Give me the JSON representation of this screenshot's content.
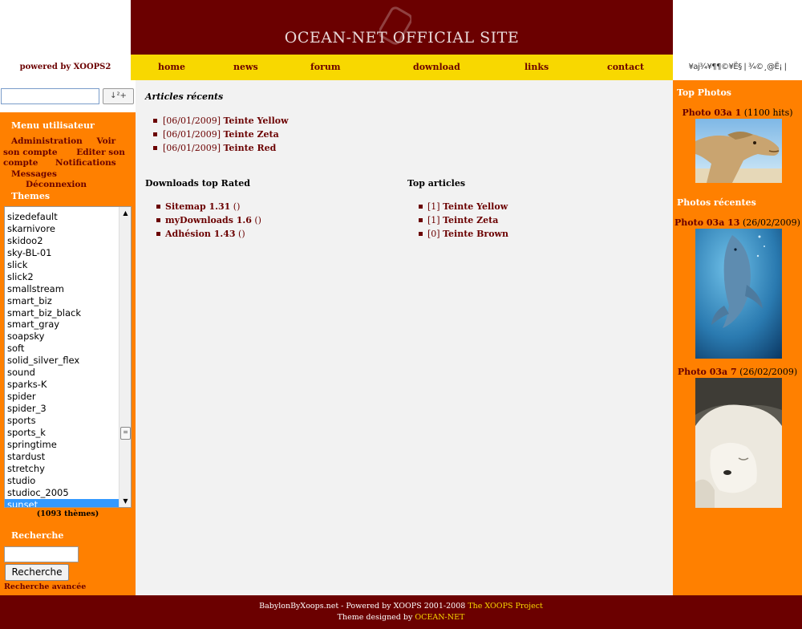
{
  "header": {
    "title": "OCEAN-NET OFFICIAL SITE",
    "powered_by": "powered by",
    "powered_brand": "XOOPS2",
    "garbled_text": "¥aj¾¥¶¶©¥Ë§ | ¾©¸@Ë¡ | ¥i¥¨¥i¥Y¥Ë"
  },
  "nav": {
    "home": "home",
    "news": "news",
    "forum": "forum",
    "download": "download",
    "links": "links",
    "contact": "contact"
  },
  "left": {
    "search_button": "↓²+",
    "user_menu_title": "Menu utilisateur",
    "user_menu": {
      "admin": "Administration",
      "view_account_1": "Voir",
      "view_account_2": "son compte",
      "edit_account_1": "Editer son",
      "edit_account_2": "compte",
      "notifications": "Notifications",
      "messages": "Messages",
      "logout": "Déconnexion"
    },
    "themes_title": "Themes",
    "themes": [
      "sizedefault",
      "skarnivore",
      "skidoo2",
      "sky-BL-01",
      "slick",
      "slick2",
      "smallstream",
      "smart_biz",
      "smart_biz_black",
      "smart_gray",
      "soapsky",
      "soft",
      "solid_silver_flex",
      "sound",
      "sparks-K",
      "spider",
      "spider_3",
      "sports",
      "sports_k",
      "springtime",
      "stardust",
      "stretchy",
      "studio",
      "studioc_2005",
      "sunset"
    ],
    "selected_theme": "sunset",
    "theme_count": "(1093 thèmes)",
    "search_title": "Recherche",
    "search_input": "",
    "search_button_label": "Recherche",
    "advanced_search": "Recherche avancée"
  },
  "center": {
    "recent_title": "Articles récents",
    "recent": [
      {
        "date": "[06/01/2009]",
        "title": "Teinte Yellow"
      },
      {
        "date": "[06/01/2009]",
        "title": "Teinte Zeta"
      },
      {
        "date": "[06/01/2009]",
        "title": "Teinte Red"
      }
    ],
    "downloads_title": "Downloads top Rated",
    "downloads": [
      {
        "title": "Sitemap 1.31",
        "extra": " ()"
      },
      {
        "title": "myDownloads 1.6",
        "extra": " ()"
      },
      {
        "title": "Adhésion 1.43",
        "extra": " ()"
      }
    ],
    "top_title": "Top articles",
    "top": [
      {
        "count": "[1]",
        "title": "Teinte Yellow"
      },
      {
        "count": "[1]",
        "title": "Teinte Zeta"
      },
      {
        "count": "[0]",
        "title": "Teinte Brown"
      }
    ]
  },
  "right": {
    "top_photos_title": "Top Photos",
    "top_photo": {
      "name": "Photo 03a 1",
      "meta": " (1100 hits)"
    },
    "recent_photos_title": "Photos récentes",
    "recent_photo_1": {
      "name": "Photo 03a 13",
      "meta": " (26/02/2009)"
    },
    "recent_photo_2": {
      "name": "Photo 03a 7",
      "meta": " (26/02/2009)"
    }
  },
  "footer": {
    "line1_prefix": "BabylonByXoops.net - Powered by XOOPS 2001-2008 ",
    "line1_link": "The XOOPS Project",
    "line2_prefix": "Theme designed by ",
    "line2_link": "OCEAN-NET"
  },
  "colors": {
    "maroon": "#6b0000",
    "yellow": "#f8d800",
    "orange": "#ff8000",
    "content_bg": "#f2f2f2"
  }
}
